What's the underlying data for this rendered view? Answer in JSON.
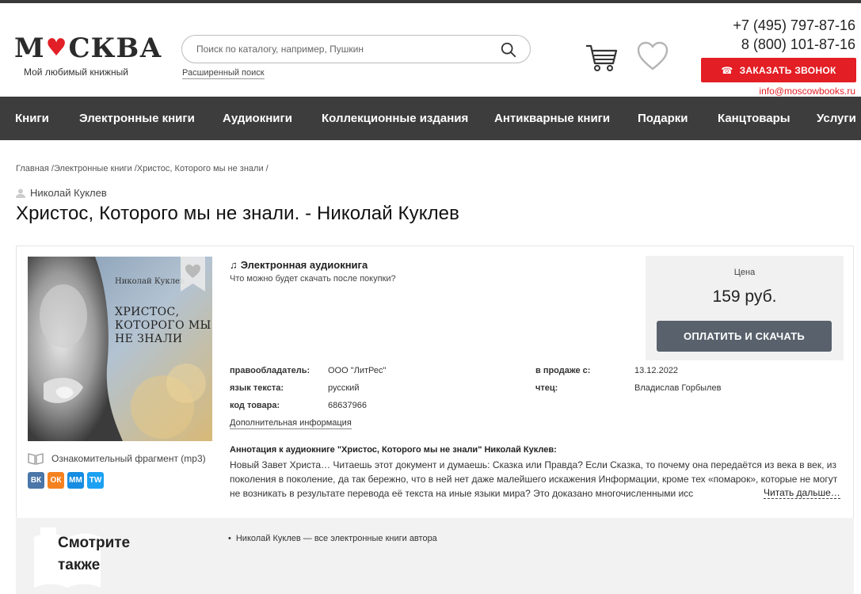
{
  "header": {
    "logo_left": "М",
    "logo_right": "СКВА",
    "logo_tagline": "Мой любимый книжный",
    "search_placeholder": "Поиск по каталогу, например, Пушкин",
    "advanced_search": "Расширенный поиск",
    "phones": [
      "+7 (495) 797-87-16",
      "8 (800) 101-87-16"
    ],
    "call_button": "ЗАКАЗАТЬ ЗВОНОК",
    "email": "info@moscowbooks.ru"
  },
  "nav": {
    "items": [
      "Книги",
      "Электронные книги",
      "Аудиокниги",
      "Коллекционные издания",
      "Антикварные книги",
      "Подарки",
      "Канцтовары",
      "Услуги"
    ]
  },
  "breadcrumb": "Главная /Электронные книги /Христос, Которого мы не знали /",
  "product": {
    "author": "Николай Куклев",
    "title": "Христос, Которого мы не знали. - Николай Куклев",
    "cover_author": "Николай Куклев",
    "cover_title_lines": [
      "ХРИСТОС,",
      "КОТОРОГО МЫ",
      "НЕ ЗНАЛИ"
    ],
    "type": "Электронная аудиокнига",
    "type_sub": "Что можно будет скачать после покупки?",
    "props": {
      "rights_label": "правообладатель:",
      "rights_value": "ООО \"ЛитРес\"",
      "lang_label": "язык текста:",
      "lang_value": "русский",
      "code_label": "код товара:",
      "code_value": "68637966",
      "sale_label": "в продаже с:",
      "sale_value": "13.12.2022",
      "reader_label": "чтец:",
      "reader_value": "Владислав Горбылев"
    },
    "more_info": "Дополнительная информация",
    "fragment": "Ознакомительный фрагмент (mp3)",
    "annotation_title": "Аннотация к аудиокниге \"Христос, Которого мы не знали\" Николай Куклев:",
    "annotation_text": "Новый Завет Христа… Читаешь этот документ и думаешь: Сказка или Правда? Если Сказка, то почему она передаётся из века в век, из поколения в поколение, да так бережно, что в ней нет даже малейшего искажения Информации, кроме тех «помарок», которые не могут не возникать в результате перевода её текста на иные языки мира? Это доказано многочисленными исс",
    "read_more": "Читать дальше…",
    "price_label": "Цена",
    "price": "159 руб.",
    "buy_button": "ОПЛАТИТЬ И СКАЧАТЬ"
  },
  "social": [
    "ВК",
    "ОК",
    "ММ",
    "TW"
  ],
  "social_colors": [
    "#4a76a8",
    "#f58220",
    "#168de2",
    "#1da1f2"
  ],
  "see_also": {
    "title": "Смотрите также",
    "items": [
      "Николай Куклев — все электронные книги автора"
    ]
  },
  "colors": {
    "accent": "#e31e24",
    "nav_bg": "#3d3d3d",
    "button": "#58616c"
  }
}
